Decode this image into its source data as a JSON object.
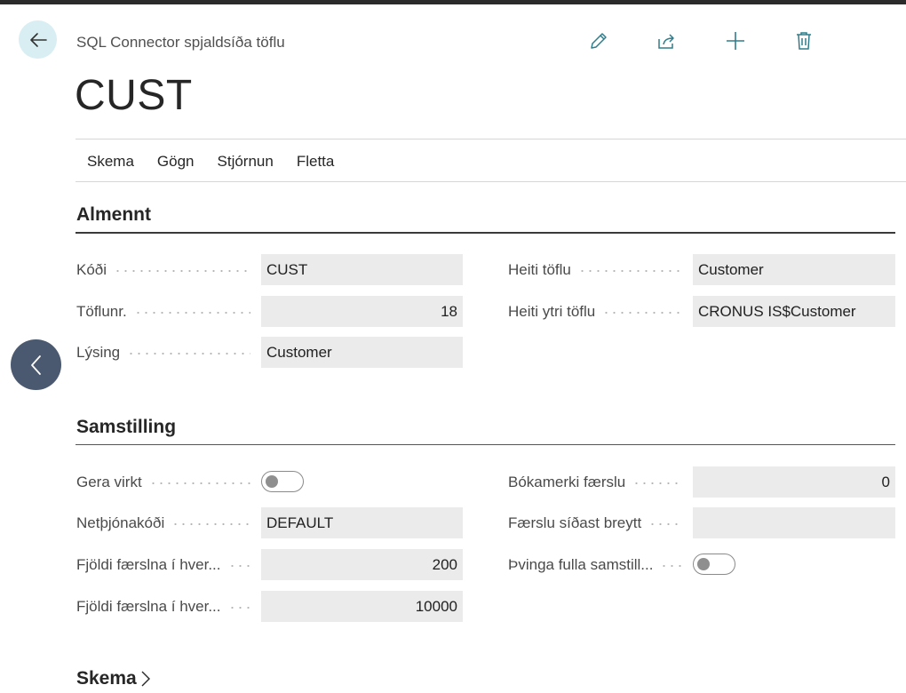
{
  "header": {
    "breadcrumb": "SQL Connector spjaldsíða töflu",
    "title": "CUST",
    "actions": [
      {
        "icon": "edit-icon"
      },
      {
        "icon": "share-icon"
      },
      {
        "icon": "add-icon"
      },
      {
        "icon": "delete-icon"
      }
    ]
  },
  "menu": {
    "items": [
      "Skema",
      "Gögn",
      "Stjórnun",
      "Fletta"
    ]
  },
  "general": {
    "title": "Almennt",
    "code_label": "Kóði",
    "code_value": "CUST",
    "table_no_label": "Töflunr.",
    "table_no_value": "18",
    "description_label": "Lýsing",
    "description_value": "Customer",
    "table_name_label": "Heiti töflu",
    "table_name_value": "Customer",
    "ext_table_name_label": "Heiti ytri töflu",
    "ext_table_name_value": "CRONUS IS$Customer"
  },
  "sync": {
    "title": "Samstilling",
    "enable_label": "Gera virkt",
    "enable_value": false,
    "server_code_label": "Netþjónakóði",
    "server_code_value": "DEFAULT",
    "records_per_1_label": "Fjöldi færslna í hver...",
    "records_per_1_value": "200",
    "records_per_2_label": "Fjöldi færslna í hver...",
    "records_per_2_value": "10000",
    "bookmark_label": "Bókamerki færslu",
    "bookmark_value": "0",
    "last_modified_label": "Færslu síðast breytt",
    "last_modified_value": "",
    "force_full_sync_label": "Þvinga fulla samstill...",
    "force_full_sync_value": false
  },
  "schema_section": {
    "title": "Skema"
  },
  "colors": {
    "accent": "#2e7d8c",
    "back_button_bg": "#d8eef2",
    "side_nav_bg": "#4a5970",
    "field_bg": "#ebebeb"
  }
}
